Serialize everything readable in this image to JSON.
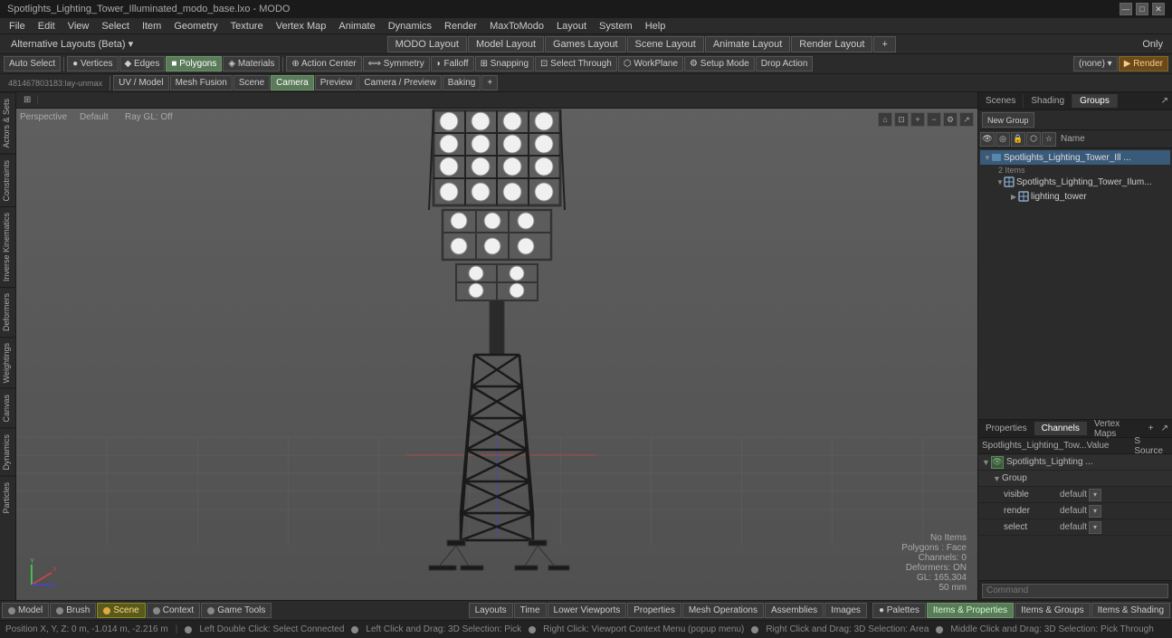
{
  "titleBar": {
    "title": "Spotlights_Lighting_Tower_Illuminated_modo_base.lxo - MODO",
    "winControls": [
      "—",
      "□",
      "✕"
    ]
  },
  "menuBar": {
    "items": [
      "File",
      "Edit",
      "View",
      "Select",
      "Item",
      "Geometry",
      "Texture",
      "Vertex Map",
      "Animate",
      "Dynamics",
      "Render",
      "MaxToModo",
      "Layout",
      "System",
      "Help"
    ]
  },
  "layoutBar": {
    "altLayouts": "Alternative Layouts (Beta) ▾",
    "tabs": [
      "MODO Layout",
      "Model Layout",
      "Games Layout",
      "Scene Layout",
      "Animate Layout",
      "Render Layout"
    ],
    "activeTab": "MODO Layout",
    "addBtn": "+",
    "onlyLabel": "Only"
  },
  "toolBar": {
    "selectionBtns": [
      "Auto Select",
      "Vertices",
      "Edges",
      "Polygons",
      "Materials"
    ],
    "activeSelection": "Polygons",
    "toolBtns": [
      "Action Center",
      "Symmetry",
      "Falloff",
      "Snapping",
      "Select Through",
      "WorkPlane",
      "Setup Mode",
      "Drop Action"
    ],
    "rightBtns": [
      "(none)",
      "Render"
    ]
  },
  "secondaryBar": {
    "location": "481467803183:lay-unmax",
    "tabs": [
      "UV / Model",
      "Mesh Fusion",
      "Scene",
      "Camera",
      "Preview",
      "Camera / Preview",
      "Baking"
    ],
    "activeTab": "Camera"
  },
  "viewport": {
    "perspective": "Perspective",
    "defaultLabel": "Default",
    "rayGL": "Ray GL: Off",
    "noItems": "No Items",
    "polygons": "Polygons: Face",
    "channels": "Channels: 0",
    "deformers": "Deformers: ON",
    "glCoords": "GL: 165,304",
    "focalLength": "50 mm"
  },
  "rightPanel": {
    "tabs": [
      "Scenes",
      "Shading",
      "Groups"
    ],
    "activeTab": "Groups",
    "expandBtn": "↗",
    "newGroupBtn": "New Group",
    "treeItems": [
      {
        "name": "Spotlights_Lighting_Tower_Ill ...",
        "type": "scene",
        "expanded": true,
        "children": [
          {
            "name": "Spotlights_Lighting_Tower_Ilum...",
            "type": "mesh",
            "expanded": true,
            "children": [
              {
                "name": "lighting_tower",
                "type": "mesh",
                "expanded": false
              }
            ]
          }
        ]
      }
    ]
  },
  "bottomPanel": {
    "tabs": [
      "Properties",
      "Channels",
      "Vertex Maps"
    ],
    "activeTab": "Channels",
    "addBtn": "+",
    "expandBtn": "↗",
    "channelsHeader": {
      "name": "Spotlights_Lighting_Tow...",
      "valueLabel": "Value",
      "sourceLabel": "S Source"
    },
    "channels": [
      {
        "indent": 0,
        "name": "Spotlights_Lighting ...",
        "type": "group-toggle",
        "icon": "eye"
      },
      {
        "indent": 1,
        "name": "Group",
        "type": "group-header"
      },
      {
        "indent": 2,
        "name": "visible",
        "value": "default",
        "source": ""
      },
      {
        "indent": 2,
        "name": "render",
        "value": "default",
        "source": ""
      },
      {
        "indent": 2,
        "name": "select",
        "value": "default",
        "source": ""
      }
    ],
    "commandPlaceholder": "Command"
  },
  "bottomBar": {
    "tabs": [
      {
        "label": "Model",
        "icon": "box",
        "active": false
      },
      {
        "label": "Brush",
        "icon": "brush",
        "active": false
      },
      {
        "label": "Scene",
        "icon": "scene",
        "active": true
      },
      {
        "label": "Context",
        "icon": "ctx",
        "active": false
      },
      {
        "label": "Game Tools",
        "icon": "game",
        "active": false
      }
    ],
    "rightTabs": [
      {
        "label": "Layouts",
        "active": false
      },
      {
        "label": "Time",
        "active": false
      },
      {
        "label": "Lower Viewports",
        "active": false
      },
      {
        "label": "Properties",
        "active": false
      },
      {
        "label": "Mesh Operations",
        "active": false
      },
      {
        "label": "Assemblies",
        "active": false
      },
      {
        "label": "Images",
        "active": false
      }
    ]
  },
  "statusBar": {
    "position": "Position X, Y, Z:  0 m, -1.014 m, -2.216 m",
    "instructions": [
      "Left Double Click: Select Connected",
      "Left Click and Drag: 3D Selection: Pick",
      "Right Click: Viewport Context Menu (popup menu)",
      "Right Click and Drag: 3D Selection: Area",
      "Middle Click and Drag: 3D Selection: Pick Through"
    ],
    "dots": [
      {
        "color": "#888888"
      },
      {
        "color": "#888888"
      },
      {
        "color": "#888888"
      },
      {
        "color": "#888888"
      }
    ]
  },
  "rightPanelTabs": {
    "tabsBottom": [
      "Items & Properties",
      "Items & Groups",
      "Items & Shading"
    ],
    "activeBottom": "Items & Properties"
  }
}
